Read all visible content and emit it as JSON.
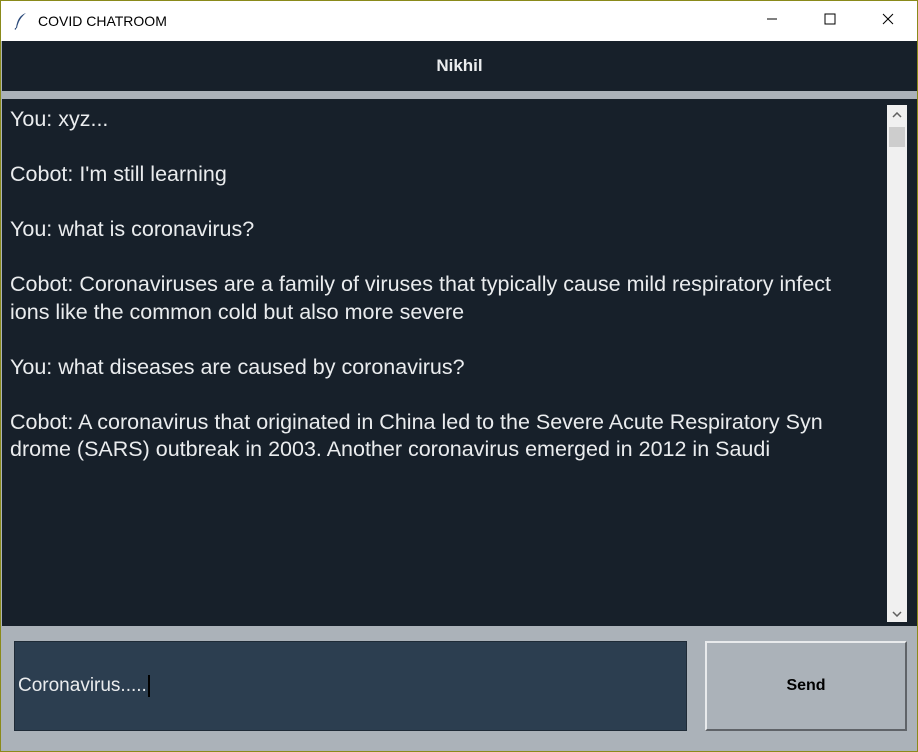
{
  "window": {
    "title": "COVID CHATROOM",
    "app_icon": "feather-icon",
    "controls": [
      "minimize-icon",
      "maximize-icon",
      "close-icon"
    ]
  },
  "header": {
    "name": "Nikhil"
  },
  "chat": {
    "messages": [
      {
        "lines": [
          "You: xyz..."
        ]
      },
      {
        "lines": [
          "Cobot: I'm still learning"
        ]
      },
      {
        "lines": [
          "You: what is coronavirus?"
        ]
      },
      {
        "lines": [
          "Cobot: Coronaviruses are a family of viruses that typically cause mild respiratory infect",
          "ions like the common cold but also more severe"
        ]
      },
      {
        "lines": [
          "You: what diseases are caused by coronavirus?"
        ]
      },
      {
        "lines": [
          "Cobot: A coronavirus that originated in China led to the Severe Acute Respiratory Syn",
          "drome (SARS) outbreak in 2003. Another coronavirus emerged in 2012 in Saudi"
        ]
      }
    ]
  },
  "input": {
    "value": "Coronavirus....."
  },
  "send_button": {
    "label": "Send"
  },
  "colors": {
    "dark_bg": "#17202a",
    "entry_bg": "#2c3e50",
    "gray": "#abb2b9",
    "text": "#eaecee"
  }
}
